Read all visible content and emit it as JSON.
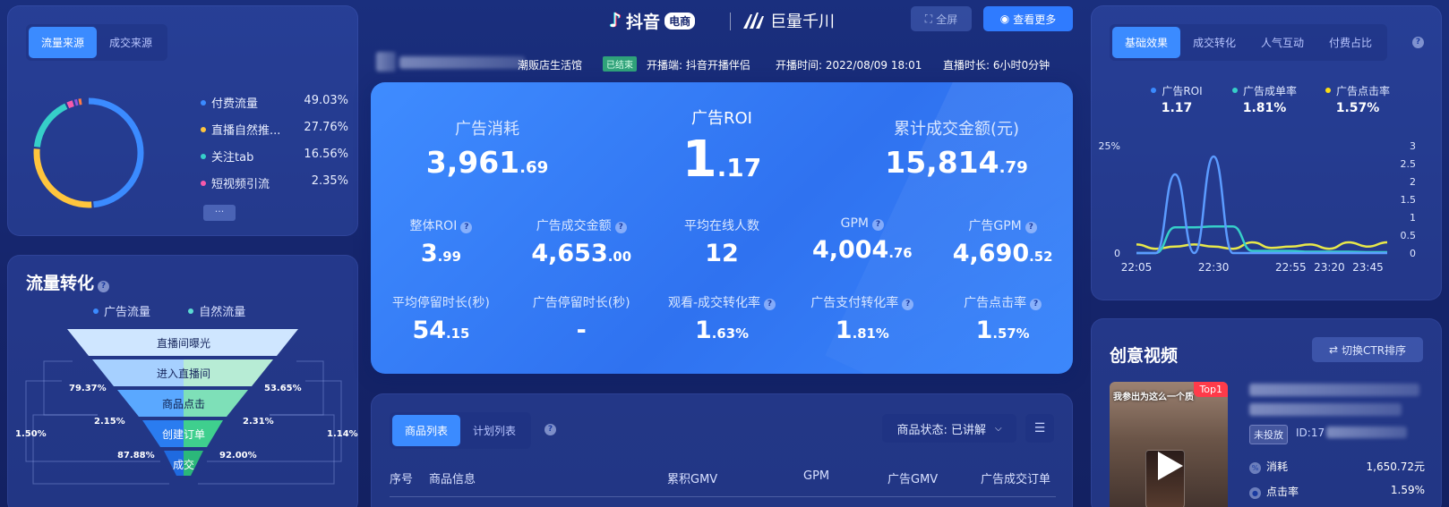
{
  "header": {
    "douyin_logo": "抖音",
    "douyin_badge": "电商",
    "qianchuan_logo": "巨量千川",
    "fullscreen_label": "全屏",
    "see_more_label": "查看更多"
  },
  "live_info": {
    "store_name": "潮贩店生活馆",
    "status_badge": "已结束",
    "broadcaster": "开播端: 抖音开播伴侣",
    "start_time": "开播时间: 2022/08/09 18:01",
    "duration": "直播时长: 6小时0分钟"
  },
  "traffic_source": {
    "tabs": [
      "流量来源",
      "成交来源"
    ],
    "active_tab": 0,
    "items": [
      {
        "label": "付费流量",
        "percent": "49.03%",
        "color": "#3b8bff"
      },
      {
        "label": "直播自然推...",
        "percent": "27.76%",
        "color": "#ffc53d"
      },
      {
        "label": "关注tab",
        "percent": "16.56%",
        "color": "#36cfc9"
      },
      {
        "label": "短视频引流",
        "percent": "2.35%",
        "color": "#f759ab"
      }
    ],
    "more_label": "···"
  },
  "traffic_conversion": {
    "title": "流量转化",
    "legend": [
      {
        "label": "广告流量",
        "color": "#3b8bff"
      },
      {
        "label": "自然流量",
        "color": "#5cdbd3"
      }
    ],
    "stages": [
      "直播间曝光",
      "进入直播间",
      "商品点击",
      "创建订单",
      "成交"
    ],
    "left_rates": [
      "79.37%",
      "2.15%",
      "87.88%"
    ],
    "right_rates": [
      "53.65%",
      "2.31%",
      "92.00%"
    ],
    "outer_left": "1.50%",
    "outer_right": "1.14%"
  },
  "kpi": {
    "ad_cost": {
      "label": "广告消耗",
      "int": "3,961",
      "dec": ".69"
    },
    "ad_roi": {
      "label": "广告ROI",
      "int": "1",
      "dec": ".17"
    },
    "gmv": {
      "label": "累计成交金额(元)",
      "int": "15,814",
      "dec": ".79"
    },
    "row2": [
      {
        "label": "整体ROI",
        "int": "3",
        "dec": ".99",
        "help": true
      },
      {
        "label": "广告成交金额",
        "int": "4,653",
        "dec": ".00",
        "help": true
      },
      {
        "label": "平均在线人数",
        "int": "12",
        "dec": "",
        "help": false
      },
      {
        "label": "GPM",
        "int": "4,004",
        "dec": ".76",
        "help": true
      },
      {
        "label": "广告GPM",
        "int": "4,690",
        "dec": ".52",
        "help": true
      }
    ],
    "row3": [
      {
        "label": "平均停留时长(秒)",
        "int": "54",
        "dec": ".15",
        "help": false
      },
      {
        "label": "广告停留时长(秒)",
        "int": "-",
        "dec": "",
        "help": false
      },
      {
        "label": "观看-成交转化率",
        "int": "1",
        "dec": ".63%",
        "help": true
      },
      {
        "label": "广告支付转化率",
        "int": "1",
        "dec": ".81%",
        "help": true
      },
      {
        "label": "广告点击率",
        "int": "1",
        "dec": ".57%",
        "help": true
      }
    ]
  },
  "product_list": {
    "tabs": [
      "商品列表",
      "计划列表"
    ],
    "active_tab": 0,
    "status_filter": "商品状态: 已讲解",
    "columns": [
      "序号",
      "商品信息",
      "累积GMV",
      "GPM",
      "广告GMV",
      "广告成交订单"
    ]
  },
  "basic_effect": {
    "tabs": [
      "基础效果",
      "成交转化",
      "人气互动",
      "付费占比"
    ],
    "active_tab": 0,
    "metrics": [
      {
        "label": "广告ROI",
        "value": "1.17",
        "color": "#3b8bff"
      },
      {
        "label": "广告成单率",
        "value": "1.81%",
        "color": "#36cfc9"
      },
      {
        "label": "广告点击率",
        "value": "1.57%",
        "color": "#fadb14"
      }
    ]
  },
  "chart_data": {
    "type": "line",
    "x": [
      "22:05",
      "22:15",
      "22:20",
      "22:25",
      "22:30",
      "22:35",
      "22:40",
      "22:45",
      "22:55",
      "23:05",
      "23:20",
      "23:30",
      "23:45",
      "23:55"
    ],
    "left_ticks": [
      "25%",
      "0"
    ],
    "right_ticks": [
      "3",
      "2.5",
      "2",
      "1.5",
      "1",
      "0.5",
      "0"
    ],
    "xticks": [
      "22:05",
      "22:30",
      "22:55",
      "23:20",
      "23:45"
    ],
    "ylim_left": [
      0,
      25
    ],
    "ylim_right": [
      0,
      3
    ],
    "series": [
      {
        "name": "广告ROI",
        "axis": "right",
        "color": "#5b9bff",
        "values": [
          0,
          0,
          2.2,
          0,
          2.7,
          0,
          0,
          0,
          0,
          0,
          0,
          0,
          0,
          0
        ]
      },
      {
        "name": "广告成单率",
        "axis": "left",
        "color": "#36cfc9",
        "values": [
          0,
          0,
          6,
          6,
          6.2,
          6.2,
          0.5,
          0.5,
          0.5,
          0.3,
          0.3,
          0.3,
          0.2,
          0.2
        ]
      },
      {
        "name": "广告点击率",
        "axis": "left",
        "color": "#e8e84a",
        "values": [
          2,
          1,
          1.5,
          2,
          1.5,
          1,
          2.5,
          1.2,
          1.5,
          2,
          1,
          2.5,
          1.5,
          2.5
        ]
      }
    ]
  },
  "creative_video": {
    "title": "创意视频",
    "sort_button": "切换CTR排序",
    "thumbnail_caption": "我参出为这么一个质",
    "top_badge": "Top1",
    "status_badge": "未投放",
    "id_label": "ID:17",
    "stats": [
      {
        "label": "消耗",
        "value": "1,650.72元"
      },
      {
        "label": "点击率",
        "value": "1.59%"
      }
    ]
  }
}
